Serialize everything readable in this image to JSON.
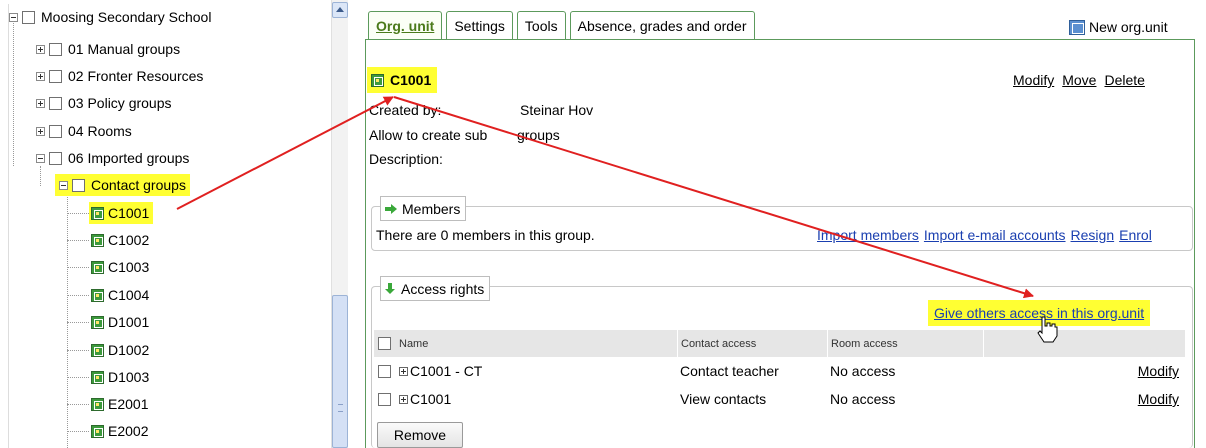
{
  "tree": {
    "root": "Moosing Secondary School",
    "folders": [
      "01 Manual groups",
      "02 Fronter Resources",
      "03 Policy groups",
      "04 Rooms",
      "06 Imported groups"
    ],
    "subfolder": "Contact groups",
    "groups": [
      "C1001",
      "C1002",
      "C1003",
      "C1004",
      "D1001",
      "D1002",
      "D1003",
      "E2001",
      "E2002"
    ]
  },
  "tabs": [
    "Org. unit",
    "Settings",
    "Tools",
    "Absence, grades and order"
  ],
  "new_org_label": "New org.unit",
  "unit": {
    "title": "C1001",
    "actions": [
      "Modify",
      "Move",
      "Delete"
    ],
    "created_by_label": "Created by:",
    "created_by_value": "Steinar Hov",
    "allow_label": "Allow to create sub",
    "allow_value": "groups",
    "description_label": "Description:"
  },
  "members": {
    "legend": "Members",
    "text": "There are 0 members in this group.",
    "links": [
      "Import members",
      "Import e-mail accounts",
      "Resign",
      "Enrol"
    ]
  },
  "access": {
    "legend": "Access rights",
    "give_access": "Give others access in this org.unit",
    "columns": [
      "Name",
      "Contact access",
      "Room access"
    ],
    "rows": [
      {
        "name": "C1001 - CT",
        "contact": "Contact teacher",
        "room": "No access",
        "action": "Modify"
      },
      {
        "name": "C1001",
        "contact": "View contacts",
        "room": "No access",
        "action": "Modify"
      }
    ],
    "remove_label": "Remove"
  },
  "colors": {
    "highlight": "#ffff33",
    "tab_border": "#5c9a5c",
    "link_blue": "#1a3fb0",
    "annotation_arrow": "#e02020"
  }
}
